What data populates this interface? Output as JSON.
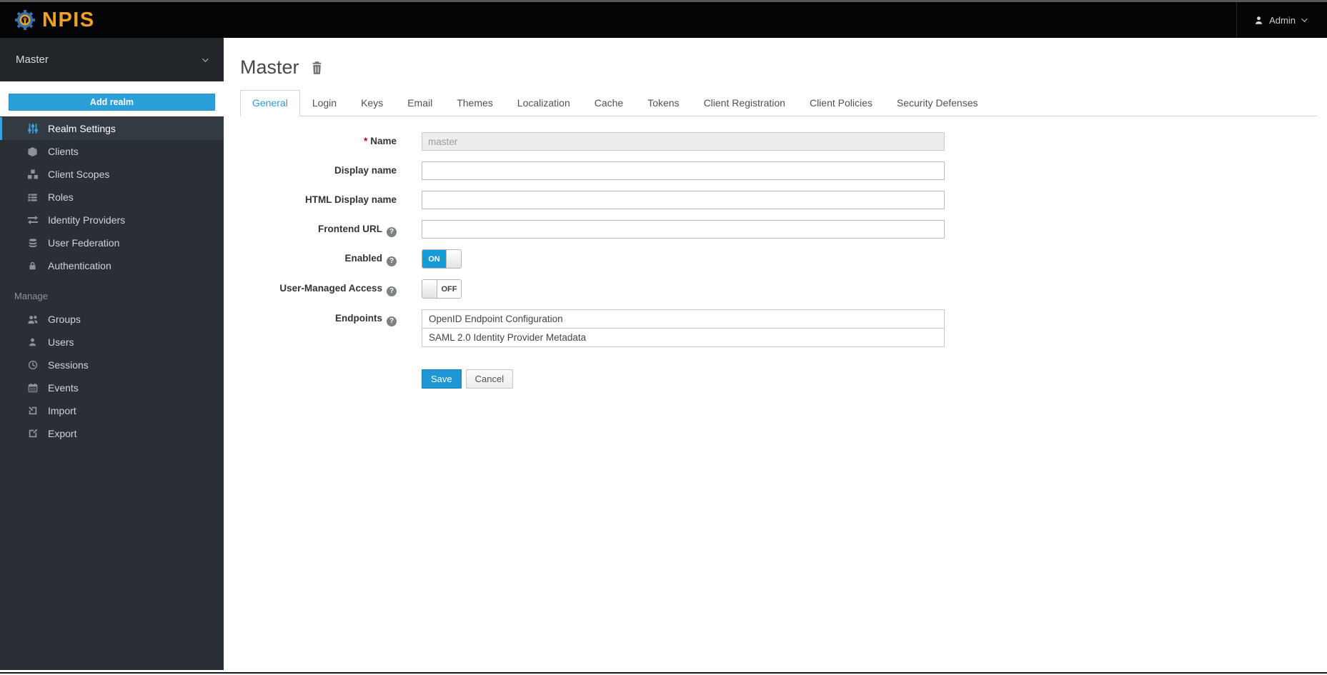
{
  "header": {
    "brand": "NPIS",
    "user": "Admin"
  },
  "sidebar": {
    "realm": "Master",
    "add_realm_label": "Add realm",
    "items": [
      {
        "label": "Realm Settings",
        "icon": "sliders-icon",
        "active": true
      },
      {
        "label": "Clients",
        "icon": "cube-icon"
      },
      {
        "label": "Client Scopes",
        "icon": "cubes-icon"
      },
      {
        "label": "Roles",
        "icon": "list-icon"
      },
      {
        "label": "Identity Providers",
        "icon": "exchange-icon"
      },
      {
        "label": "User Federation",
        "icon": "database-icon"
      },
      {
        "label": "Authentication",
        "icon": "lock-icon"
      }
    ],
    "manage_header": "Manage",
    "manage_items": [
      {
        "label": "Groups",
        "icon": "users-icon"
      },
      {
        "label": "Users",
        "icon": "user-icon"
      },
      {
        "label": "Sessions",
        "icon": "clock-icon"
      },
      {
        "label": "Events",
        "icon": "calendar-icon"
      },
      {
        "label": "Import",
        "icon": "import-icon"
      },
      {
        "label": "Export",
        "icon": "export-icon"
      }
    ]
  },
  "main": {
    "title": "Master",
    "tabs": [
      {
        "label": "General",
        "active": true
      },
      {
        "label": "Login"
      },
      {
        "label": "Keys"
      },
      {
        "label": "Email"
      },
      {
        "label": "Themes"
      },
      {
        "label": "Localization"
      },
      {
        "label": "Cache"
      },
      {
        "label": "Tokens"
      },
      {
        "label": "Client Registration"
      },
      {
        "label": "Client Policies"
      },
      {
        "label": "Security Defenses"
      }
    ],
    "form": {
      "name": {
        "label": "Name",
        "required": "*",
        "value": "master"
      },
      "display_name": {
        "label": "Display name",
        "value": ""
      },
      "html_display_name": {
        "label": "HTML Display name",
        "value": ""
      },
      "frontend_url": {
        "label": "Frontend URL",
        "value": ""
      },
      "enabled": {
        "label": "Enabled",
        "state": "ON"
      },
      "user_managed_access": {
        "label": "User-Managed Access",
        "state": "OFF"
      },
      "endpoints": {
        "label": "Endpoints",
        "links": [
          "OpenID Endpoint Configuration",
          "SAML 2.0 Identity Provider Metadata"
        ]
      },
      "save_label": "Save",
      "cancel_label": "Cancel"
    }
  },
  "colors": {
    "accent_blue": "#2b9fd9",
    "toggle_on_blue": "#149cd8",
    "brand_orange": "#f0a125",
    "topbar_bg": "#040404",
    "sidebar_bg": "#2a2f36",
    "active_item_border": "#39a5dc",
    "required_red": "#cc0000"
  }
}
